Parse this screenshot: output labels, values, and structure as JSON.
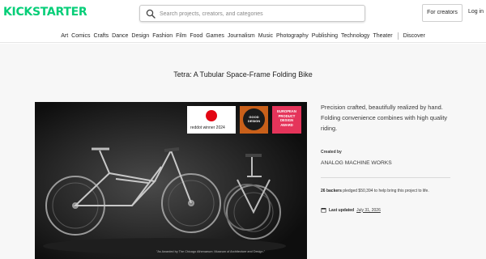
{
  "header": {
    "logo": "KICKSTARTER",
    "search_placeholder": "Search projects, creators, and categories",
    "for_creators": "For creators",
    "login": "Log in"
  },
  "nav": {
    "categories": [
      "Art",
      "Comics",
      "Crafts",
      "Dance",
      "Design",
      "Fashion",
      "Film",
      "Food",
      "Games",
      "Journalism",
      "Music",
      "Photography",
      "Publishing",
      "Technology",
      "Theater"
    ],
    "discover": "Discover"
  },
  "project": {
    "title": "Tetra: A Tubular Space-Frame Folding Bike",
    "description": "Precision crafted, beautifully realized by hand. Folding convenience combines with high quality riding.",
    "created_by_label": "Created by",
    "creator": "ANALOG MACHINE WORKS",
    "backers_count": "26 backers",
    "pledge_text": "pledged $50,394 to help bring this project to life.",
    "last_updated_label": "Last updated",
    "last_updated_date": "July 31, 2026"
  },
  "hero": {
    "awards": {
      "reddot": "reddot winner 2024",
      "good_design_line1": "GOOD",
      "good_design_line2": "DESIGN",
      "european_line1": "EUROPEAN",
      "european_line2": "PRODUCT",
      "european_line3": "DESIGN",
      "european_line4": "AWARD"
    },
    "caption": "\"As Awarded by The Chicago Athenaeum: Museum of Architecture and Design.\""
  },
  "colors": {
    "brand": "#05ce78",
    "good_design": "#c9601a",
    "european_award": "#e5345a",
    "reddot": "#e30613"
  },
  "icons": [
    "search-icon",
    "calendar-icon",
    "reddot-logo-icon"
  ]
}
